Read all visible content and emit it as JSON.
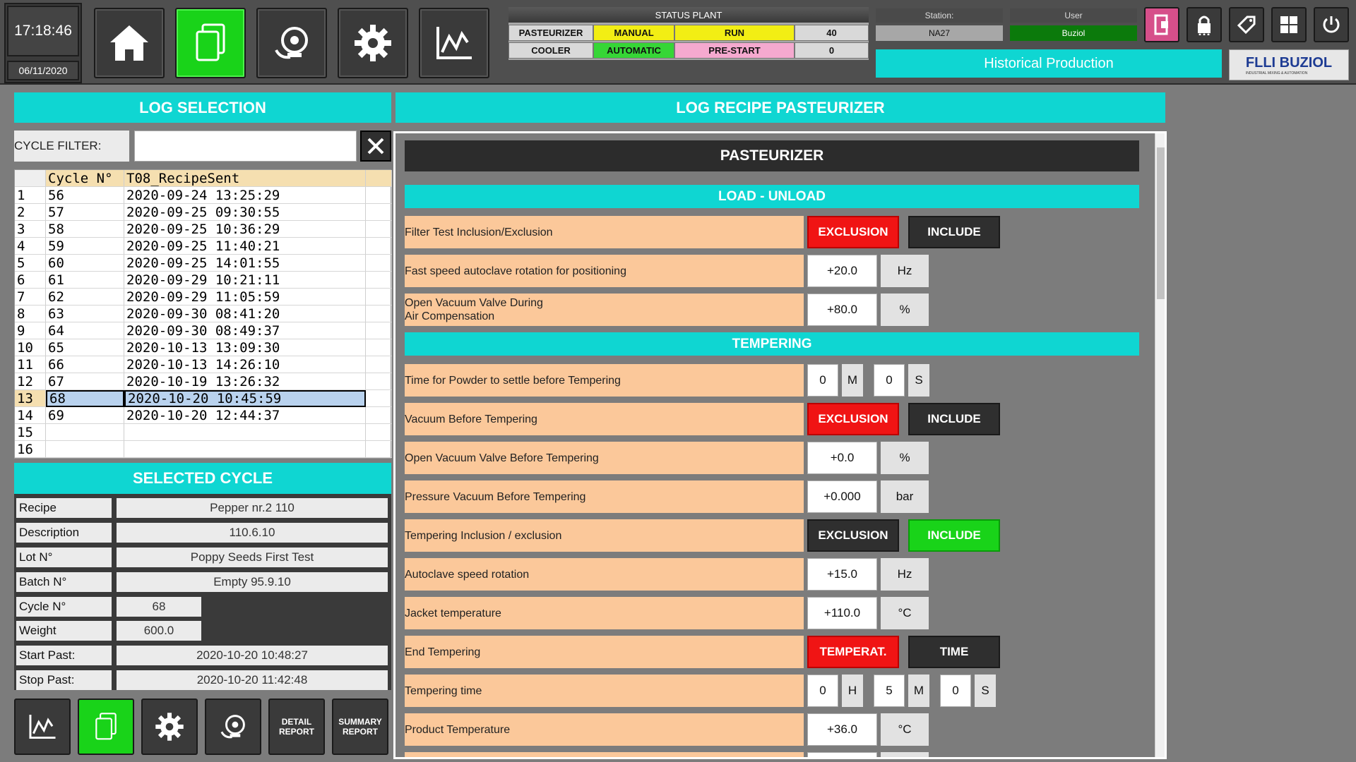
{
  "clock": {
    "time": "17:18:46",
    "date": "06/11/2020"
  },
  "nav_buttons": [
    {
      "icon": "home-icon"
    },
    {
      "icon": "documents-icon",
      "active": true
    },
    {
      "icon": "alarm-bell-icon"
    },
    {
      "icon": "gear-icon"
    },
    {
      "icon": "line-chart-icon"
    }
  ],
  "status_plant": {
    "title": "STATUS PLANT",
    "rows": [
      {
        "name": "PASTEURIZER",
        "mode": "MANUAL",
        "state": "RUN",
        "value": "40"
      },
      {
        "name": "COOLER",
        "mode": "AUTOMATIC",
        "state": "PRE-START",
        "value": "0"
      }
    ]
  },
  "station": {
    "label": "Station:",
    "value": "NA27"
  },
  "user": {
    "label": "User",
    "value": "Buziol"
  },
  "page_banner": "Historical Production",
  "logo": {
    "name": "FLLI BUZIOL",
    "tagline": "INDUSTRIAL MIXING & AUTOMATION"
  },
  "system_icons": [
    "logout-icon",
    "lock-icon",
    "tag-icon",
    "windows-icon",
    "power-icon"
  ],
  "left": {
    "log_selection_title": "LOG SELECTION",
    "cycle_filter_label": "CYCLE FILTER:",
    "cycle_filter_value": "",
    "table": {
      "headers": [
        "",
        "Cycle N°",
        "T08_RecipeSent",
        ""
      ],
      "rows": [
        [
          "1",
          "56",
          "2020-09-24 13:25:29"
        ],
        [
          "2",
          "57",
          "2020-09-25 09:30:55"
        ],
        [
          "3",
          "58",
          "2020-09-25 10:36:29"
        ],
        [
          "4",
          "59",
          "2020-09-25 11:40:21"
        ],
        [
          "5",
          "60",
          "2020-09-25 14:01:55"
        ],
        [
          "6",
          "61",
          "2020-09-29 10:21:11"
        ],
        [
          "7",
          "62",
          "2020-09-29 11:05:59"
        ],
        [
          "8",
          "63",
          "2020-09-30 08:41:20"
        ],
        [
          "9",
          "64",
          "2020-09-30 08:49:37"
        ],
        [
          "10",
          "65",
          "2020-10-13 13:09:30"
        ],
        [
          "11",
          "66",
          "2020-10-13 14:26:10"
        ],
        [
          "12",
          "67",
          "2020-10-19 13:26:32"
        ],
        [
          "13",
          "68",
          "2020-10-20 10:45:59"
        ],
        [
          "14",
          "69",
          "2020-10-20 12:44:37"
        ],
        [
          "15",
          "",
          ""
        ],
        [
          "16",
          "",
          ""
        ]
      ],
      "selected_row": 13
    },
    "selected_cycle_title": "SELECTED CYCLE",
    "selected_cycle": {
      "recipe_label": "Recipe",
      "recipe": "Pepper nr.2 110",
      "description_label": "Description",
      "description": "110.6.10",
      "lot_label": "Lot N°",
      "lot": "Poppy Seeds First Test",
      "batch_label": "Batch N°",
      "batch": "Empty 95.9.10",
      "cycle_label": "Cycle N°",
      "cycle": "68",
      "weight_label": "Weight",
      "weight": "600.0",
      "start_label": "Start Past:",
      "start": "2020-10-20 10:48:27",
      "stop_label": "Stop Past:",
      "stop": "2020-10-20 11:42:48"
    },
    "bottom_buttons": {
      "detail_report": "DETAIL REPORT",
      "summary_report": "SUMMARY REPORT"
    }
  },
  "right": {
    "title": "LOG RECIPE PASTEURIZER",
    "subtitle": "PASTEURIZER",
    "sections": {
      "load_unload": "LOAD - UNLOAD",
      "tempering": "TEMPERING"
    },
    "params": {
      "filter_test": {
        "label": "Filter Test Inclusion/Exclusion",
        "opt1": "EXCLUSION",
        "opt2": "INCLUDE"
      },
      "fast_speed": {
        "label": "Fast speed autoclave rotation for positioning",
        "value": "+20.0",
        "unit": "Hz"
      },
      "open_vacuum_air": {
        "label_line1": "Open Vacuum Valve During",
        "label_line2": "Air Compensation",
        "value": "+80.0",
        "unit": "%"
      },
      "powder_settle": {
        "label": "Time for Powder to settle before Tempering",
        "min": "0",
        "min_unit": "M",
        "sec": "0",
        "sec_unit": "S"
      },
      "vacuum_before": {
        "label": "Vacuum Before Tempering",
        "opt1": "EXCLUSION",
        "opt2": "INCLUDE"
      },
      "open_vacuum_before": {
        "label": "Open Vacuum Valve Before Tempering",
        "value": "+0.0",
        "unit": "%"
      },
      "pressure_vacuum": {
        "label": "Pressure Vacuum Before Tempering",
        "value": "+0.000",
        "unit": "bar"
      },
      "tempering_incl": {
        "label": "Tempering  Inclusion / exclusion",
        "opt1": "EXCLUSION",
        "opt2": "INCLUDE"
      },
      "autoclave_speed": {
        "label": "Autoclave speed rotation",
        "value": "+15.0",
        "unit": "Hz"
      },
      "jacket_temp": {
        "label": "Jacket temperature",
        "value": "+110.0",
        "unit": "°C"
      },
      "end_tempering": {
        "label": "End Tempering",
        "opt1": "TEMPERAT.",
        "opt2": "TIME"
      },
      "tempering_time": {
        "label": "Tempering time",
        "h": "0",
        "h_unit": "H",
        "m": "5",
        "m_unit": "M",
        "s": "0",
        "s_unit": "S"
      },
      "product_temp": {
        "label": "Product Temperature",
        "value": "+36.0",
        "unit": "°C"
      }
    }
  }
}
